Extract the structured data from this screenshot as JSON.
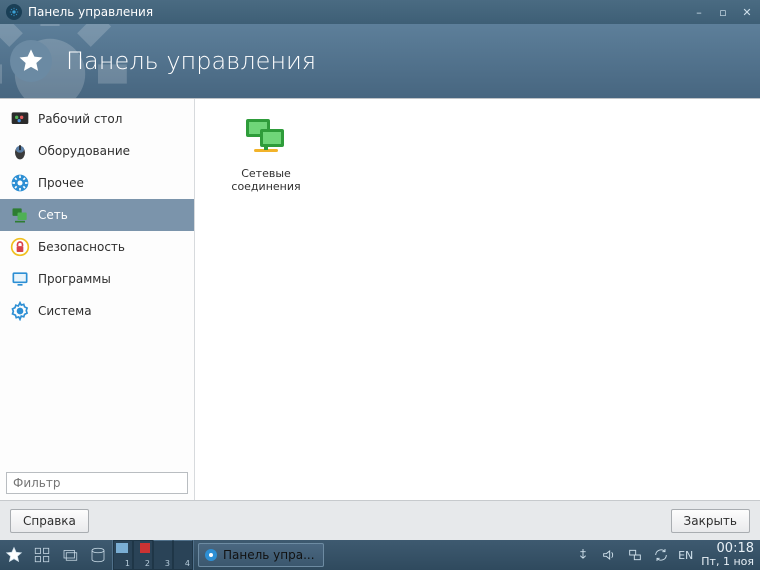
{
  "titlebar": {
    "title": "Панель управления"
  },
  "banner": {
    "heading": "Панель управления"
  },
  "sidebar": {
    "items": [
      {
        "label": "Рабочий стол"
      },
      {
        "label": "Оборудование"
      },
      {
        "label": "Прочее"
      },
      {
        "label": "Сеть"
      },
      {
        "label": "Безопасность"
      },
      {
        "label": "Программы"
      },
      {
        "label": "Система"
      }
    ],
    "filter_placeholder": "Фильтр"
  },
  "content": {
    "tiles": [
      {
        "label": "Сетевые соединения"
      }
    ]
  },
  "footer": {
    "help_label": "Справка",
    "close_label": "Закрыть"
  },
  "taskbar": {
    "pager": {
      "desktops": [
        "1",
        "2",
        "3",
        "4"
      ]
    },
    "active_task": "Панель упра...",
    "lang": "EN",
    "clock": {
      "time": "00:18",
      "date": "Пт, 1 ноя"
    }
  },
  "colors": {
    "accent": "#476680",
    "selected": "#7b94ab"
  }
}
